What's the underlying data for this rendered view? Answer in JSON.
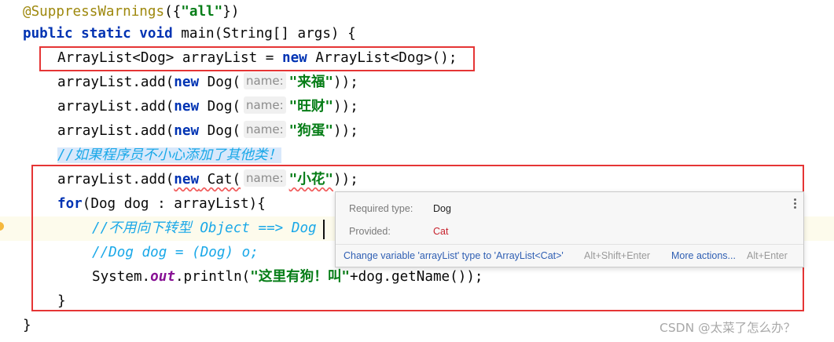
{
  "code": {
    "l0_annotation": "@SuppressWarnings",
    "l0_open": "({",
    "l0_string": "\"all\"",
    "l0_close": "})",
    "l1_kw": "public static void",
    "l1_rest": " main(String[] args) {",
    "l2_type": "ArrayList<Dog> arrayList = ",
    "l2_new": "new",
    "l2_rest": " ArrayList<Dog>();",
    "add_prefix": "arrayList.add(",
    "new_kw": "new",
    "dog_ctor": " Dog(",
    "param_hint": "name:",
    "dog1": "\"来福\"",
    "dog2": "\"旺财\"",
    "dog3": "\"狗蛋\"",
    "call_close": "));",
    "comment1": "//如果程序员不小心添加了其他类！",
    "cat_ctor": " Cat(",
    "cat_name": "\"小花\"",
    "for_kw": "for",
    "for_rest": "(Dog dog : arrayList){",
    "comment2": "//不用向下转型 Object ==> Dog",
    "comment3": "//Dog dog = (Dog) o;",
    "println_prefix": "System.",
    "println_field": "out",
    "println_mid": ".println(",
    "println_str": "\"这里有狗！叫\"",
    "println_rest": "+dog.getName());",
    "close_for": "}",
    "close_main": "}"
  },
  "popup": {
    "required_label": "Required type:",
    "required_value": "Dog",
    "provided_label": "Provided:",
    "provided_value": "Cat",
    "fix_action": "Change variable 'arrayList' type to 'ArrayList<Cat>'",
    "fix_shortcut": "Alt+Shift+Enter",
    "more_actions": "More actions...",
    "more_shortcut": "Alt+Enter",
    "more_icon": "vertical-ellipsis-icon"
  },
  "watermark": "CSDN @太菜了怎么办？",
  "colors": {
    "keyword": "#0033b3",
    "string": "#067d17",
    "comment": "#1aa8e8",
    "annotation": "#9e880d",
    "error_box": "#e53535",
    "provided_value": "#c7222d",
    "link": "#2f5fb3"
  }
}
